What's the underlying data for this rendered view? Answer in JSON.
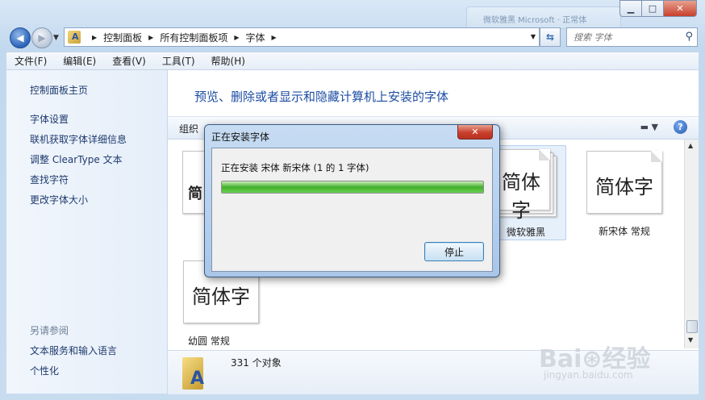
{
  "window": {
    "background_tab_text": "微软雅黑 Microsoft · 正常体",
    "minimize_glyph": "▁",
    "maximize_glyph": "□",
    "close_glyph": "✕"
  },
  "address_bar": {
    "breadcrumbs": [
      "控制面板",
      "所有控制面板项",
      "字体"
    ],
    "separator": "▶"
  },
  "search": {
    "placeholder": "搜索 字体"
  },
  "menu": [
    "文件(F)",
    "编辑(E)",
    "查看(V)",
    "工具(T)",
    "帮助(H)"
  ],
  "left_pane": {
    "home": "控制面板主页",
    "tasks": [
      "字体设置",
      "联机获取字体详细信息",
      "调整 ClearType 文本",
      "查找字符",
      "更改字体大小"
    ],
    "see_also_heading": "另请参阅",
    "see_also": [
      "文本服务和输入语言",
      "个性化"
    ]
  },
  "main": {
    "title": "预览、删除或者显示和隐藏计算机上安装的字体",
    "toolbar": {
      "organize": "组织",
      "help_glyph": "?"
    },
    "fonts": [
      {
        "preview": "简体字",
        "label": "新宋体 常规"
      },
      {
        "preview": "简体字",
        "label": "微软雅黑"
      },
      {
        "preview": "简",
        "label": ""
      },
      {
        "preview": "简体字",
        "label": "幼圆 常规"
      }
    ],
    "status": {
      "count": "331 个对象"
    }
  },
  "dialog": {
    "title": "正在安装字体",
    "close_glyph": "✕",
    "message": "正在安装 宋体  新宋体 (1 的 1 字体)",
    "progress": 1.0,
    "stop_button": "停止"
  },
  "watermark": {
    "brand": "Bai⊛经验",
    "url": "jingyan.baidu.com"
  },
  "colors": {
    "link": "#1e3a6e",
    "title": "#1d4da3",
    "progress": "#41b02b",
    "close": "#c7402d"
  }
}
